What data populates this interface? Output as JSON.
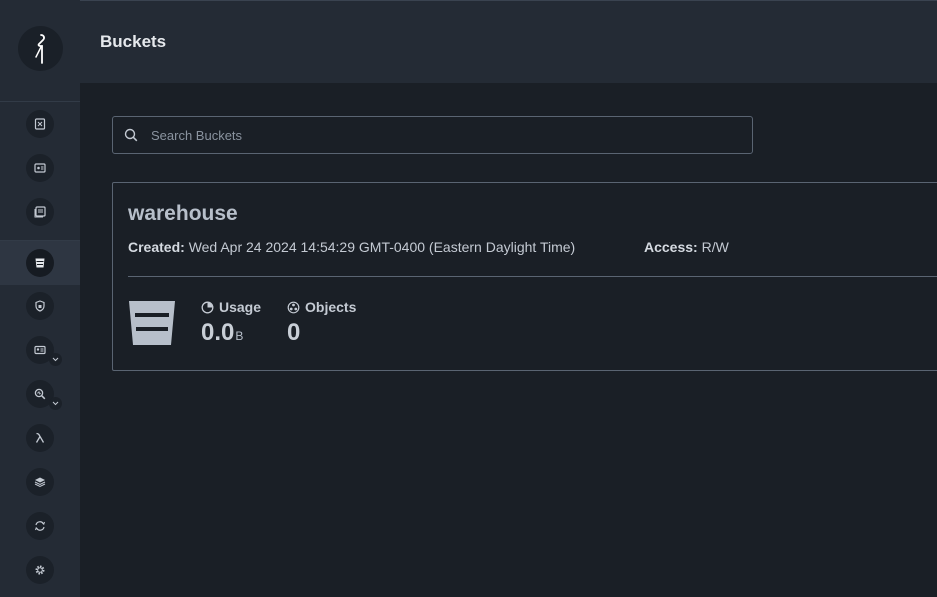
{
  "header": {
    "title": "Buckets"
  },
  "search": {
    "placeholder": "Search Buckets",
    "value": ""
  },
  "sidebar": {
    "items": [
      {
        "icon": "object-browser-icon"
      },
      {
        "icon": "access-keys-icon"
      },
      {
        "icon": "documentation-icon"
      },
      {
        "icon": "buckets-icon",
        "active": true
      },
      {
        "icon": "policies-icon"
      },
      {
        "icon": "identity-icon",
        "expandable": true
      },
      {
        "icon": "monitoring-icon",
        "expandable": true
      },
      {
        "icon": "events-icon"
      },
      {
        "icon": "tiering-icon"
      },
      {
        "icon": "replication-icon"
      },
      {
        "icon": "settings-icon"
      }
    ]
  },
  "bucket": {
    "name": "warehouse",
    "created_label": "Created:",
    "created_value": "Wed Apr 24 2024 14:54:29 GMT-0400 (Eastern Daylight Time)",
    "access_label": "Access:",
    "access_value": "R/W",
    "usage_label": "Usage",
    "usage_value": "0.0",
    "usage_unit": "B",
    "objects_label": "Objects",
    "objects_value": "0"
  },
  "colors": {
    "background": "#1a1f26",
    "sidebar": "#242b35",
    "border": "#5a6472",
    "text": "#c4cad3"
  }
}
